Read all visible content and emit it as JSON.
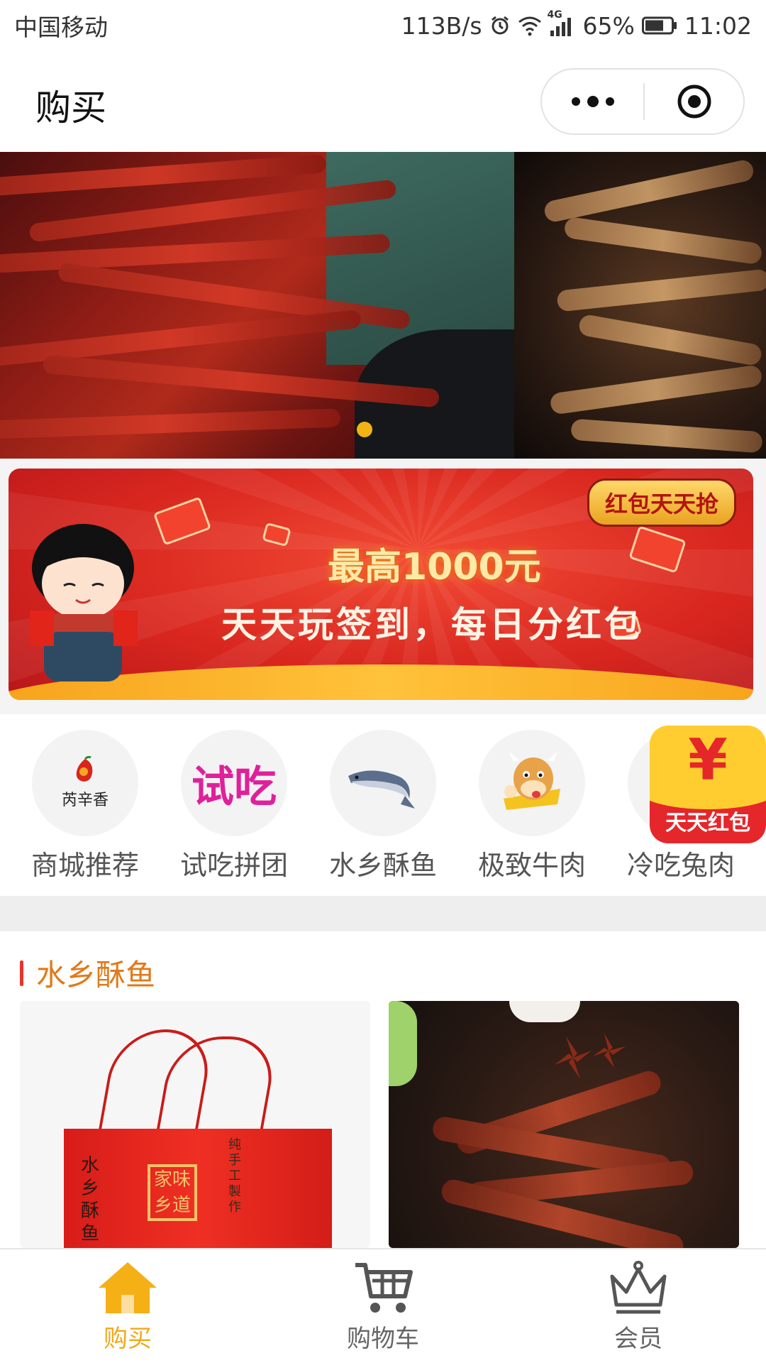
{
  "status_bar": {
    "carrier": "中国移动",
    "speed": "113B/s",
    "network": "4G",
    "battery": "65%",
    "time": "11:02",
    "icons": [
      "alarm-icon",
      "wifi-icon",
      "signal-icon",
      "battery-icon"
    ]
  },
  "nav": {
    "title": "购买",
    "capsule": {
      "more_icon": "more-dots-icon",
      "close_icon": "target-close-icon"
    }
  },
  "hero": {
    "slides": [
      "spicy-beef-jerky-image",
      "crispy-fish-image"
    ],
    "active_index": 0,
    "indicator_color": "#f2b313"
  },
  "promo": {
    "badge": "红包天天抢",
    "headline": "最高1000元",
    "tagline": "天天玩签到，每日分红包"
  },
  "categories": [
    {
      "label": "商城推荐",
      "icon": "shop-logo-icon",
      "logo_text": "芮辛香"
    },
    {
      "label": "试吃拼团",
      "icon": "taste-text-icon",
      "logo_text": "试吃"
    },
    {
      "label": "水乡酥鱼",
      "icon": "fish-icon"
    },
    {
      "label": "极致牛肉",
      "icon": "cow-mascot-icon"
    },
    {
      "label": "冷吃兔肉",
      "icon": "rabbit-icon"
    }
  ],
  "floating_redpacket": {
    "symbol": "¥",
    "text": "天天红包"
  },
  "section": {
    "title": "水乡酥鱼",
    "accent": "#e8352a",
    "title_color": "#e07a1a",
    "products": [
      {
        "image": "gift-box-image",
        "box_text": "水乡酥鱼",
        "seal_text": "家味乡道",
        "craft_text": "纯手工製作"
      },
      {
        "image": "fried-fish-image"
      }
    ]
  },
  "tab_bar": {
    "active_color": "#f2a918",
    "tabs": [
      {
        "label": "购买",
        "icon": "home-icon",
        "active": true
      },
      {
        "label": "购物车",
        "icon": "cart-icon",
        "active": false
      },
      {
        "label": "会员",
        "icon": "crown-icon",
        "active": false
      }
    ]
  }
}
